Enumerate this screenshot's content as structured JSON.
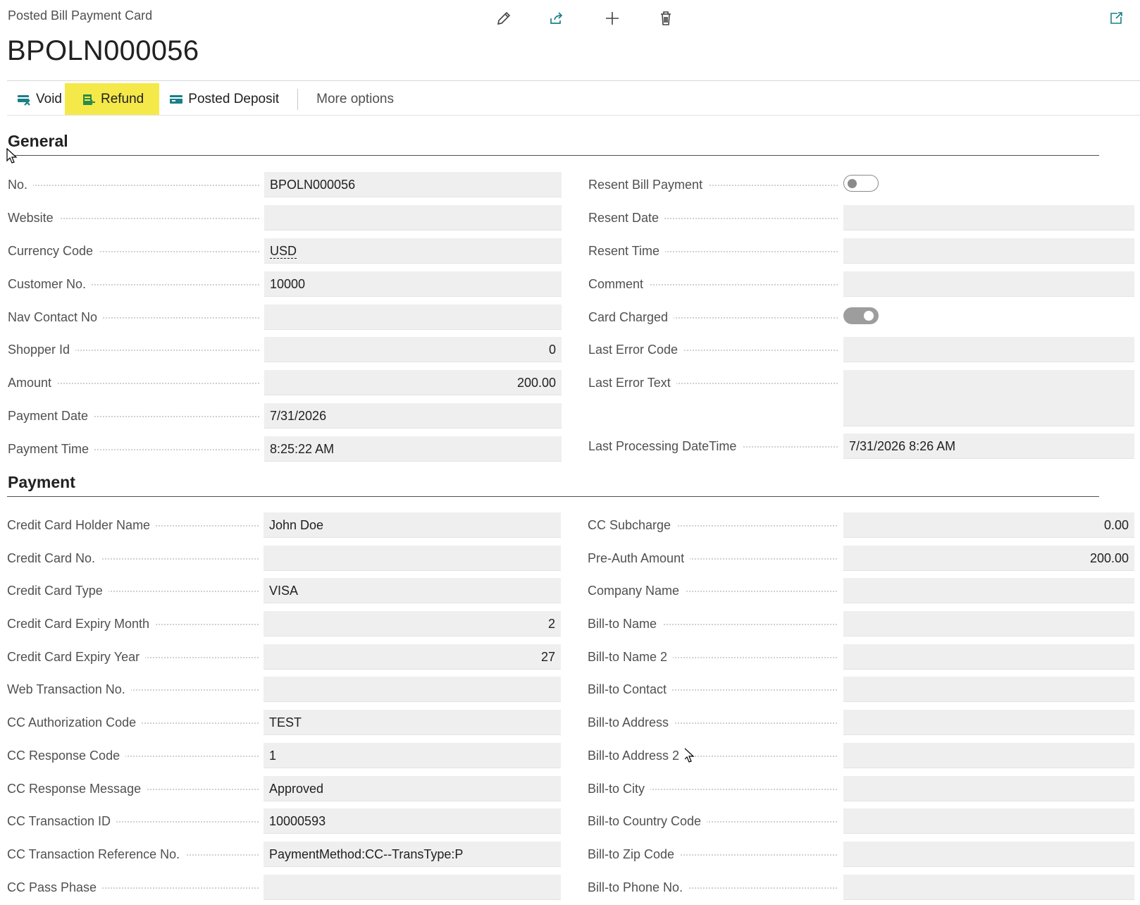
{
  "header": {
    "breadcrumb": "Posted Bill Payment Card",
    "title": "BPOLN000056",
    "icons": [
      "pencil-icon",
      "share-icon",
      "plus-icon",
      "trash-icon",
      "open-in-new-window-icon"
    ]
  },
  "actions": {
    "void": "Void",
    "refund": "Refund",
    "posted_deposit": "Posted Deposit",
    "more_options": "More options",
    "highlight_color": "#f5e94a"
  },
  "general": {
    "title": "General",
    "left": [
      {
        "label": "No.",
        "value": "BPOLN000056",
        "align": "left"
      },
      {
        "label": "Website",
        "value": "",
        "align": "left"
      },
      {
        "label": "Currency Code",
        "value": "USD",
        "align": "left"
      },
      {
        "label": "Customer No.",
        "value": "10000",
        "align": "left"
      },
      {
        "label": "Nav Contact No",
        "value": "",
        "align": "left"
      },
      {
        "label": "Shopper Id",
        "value": "0",
        "align": "right"
      },
      {
        "label": "Amount",
        "value": "200.00",
        "align": "right"
      },
      {
        "label": "Payment Date",
        "value": "7/31/2026",
        "align": "left"
      },
      {
        "label": "Payment Time",
        "value": "8:25:22 AM",
        "align": "left"
      }
    ],
    "right": [
      {
        "label": "Resent Bill Payment",
        "toggle": false
      },
      {
        "label": "Resent Date",
        "value": ""
      },
      {
        "label": "Resent Time",
        "value": ""
      },
      {
        "label": "Comment",
        "value": ""
      },
      {
        "label": "Card Charged",
        "toggle": true
      },
      {
        "label": "Last Error Code",
        "value": ""
      },
      {
        "label": "Last Error Text",
        "value": ""
      },
      {
        "label": "Last Processing DateTime",
        "value": "7/31/2026 8:26 AM"
      }
    ]
  },
  "payment": {
    "title": "Payment",
    "left": [
      {
        "label": "Credit Card Holder Name",
        "value": "John Doe",
        "align": "left"
      },
      {
        "label": "Credit Card No.",
        "value": "",
        "align": "left"
      },
      {
        "label": "Credit Card Type",
        "value": "VISA",
        "align": "left"
      },
      {
        "label": "Credit Card Expiry Month",
        "value": "2",
        "align": "right"
      },
      {
        "label": "Credit Card Expiry Year",
        "value": "27",
        "align": "right"
      },
      {
        "label": "Web Transaction No.",
        "value": "",
        "align": "left"
      },
      {
        "label": "CC Authorization Code",
        "value": "TEST",
        "align": "left"
      },
      {
        "label": "CC Response Code",
        "value": "1",
        "align": "left"
      },
      {
        "label": "CC Response Message",
        "value": "Approved",
        "align": "left"
      },
      {
        "label": "CC Transaction ID",
        "value": "10000593",
        "align": "left"
      },
      {
        "label": "CC Transaction Reference No.",
        "value": "PaymentMethod:CC--TransType:P",
        "align": "left"
      },
      {
        "label": "CC Pass Phase",
        "value": "",
        "align": "left"
      }
    ],
    "right": [
      {
        "label": "CC Subcharge",
        "value": "0.00",
        "align": "right"
      },
      {
        "label": "Pre-Auth Amount",
        "value": "200.00",
        "align": "right"
      },
      {
        "label": "Company Name",
        "value": "",
        "align": "left"
      },
      {
        "label": "Bill-to Name",
        "value": "",
        "align": "left"
      },
      {
        "label": "Bill-to Name 2",
        "value": "",
        "align": "left"
      },
      {
        "label": "Bill-to Contact",
        "value": "",
        "align": "left"
      },
      {
        "label": "Bill-to Address",
        "value": "",
        "align": "left"
      },
      {
        "label": "Bill-to Address 2",
        "value": "",
        "align": "left"
      },
      {
        "label": "Bill-to City",
        "value": "",
        "align": "left"
      },
      {
        "label": "Bill-to Country Code",
        "value": "",
        "align": "left"
      },
      {
        "label": "Bill-to Zip Code",
        "value": "",
        "align": "left"
      },
      {
        "label": "Bill-to Phone No.",
        "value": "",
        "align": "left"
      }
    ]
  }
}
